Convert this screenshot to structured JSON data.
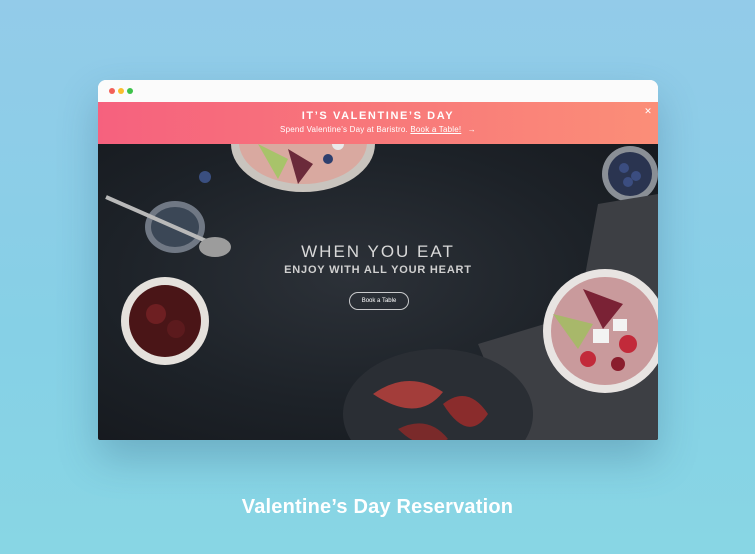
{
  "banner": {
    "title": "IT’S VALENTINE’S DAY",
    "subtitle": "Spend Valentine’s Day at Baristro.",
    "link": "Book a Table!",
    "arrow_icon": "arrow-right-icon",
    "close_icon": "close-icon"
  },
  "hero": {
    "line1": "WHEN YOU EAT",
    "line2": "ENJOY WITH ALL YOUR HEART",
    "button": "Book a Table"
  },
  "caption": "Valentine’s Day Reservation",
  "colors": {
    "background": "#8fcde8",
    "banner_start": "#f6617e",
    "banner_end": "#fb8e78",
    "hero_bg": "#1d2228"
  }
}
